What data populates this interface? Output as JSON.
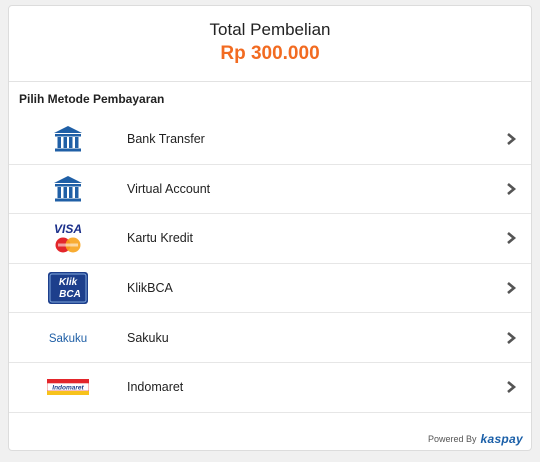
{
  "header": {
    "title": "Total Pembelian",
    "amount": "Rp 300.000"
  },
  "section_title": "Pilih Metode Pembayaran",
  "methods": [
    {
      "label": "Bank Transfer",
      "icon": "bank-icon"
    },
    {
      "label": "Virtual Account",
      "icon": "bank-icon"
    },
    {
      "label": "Kartu Kredit",
      "icon": "visa-mastercard-logo"
    },
    {
      "label": "KlikBCA",
      "icon": "klikbca-logo"
    },
    {
      "label": "Sakuku",
      "icon": "sakuku-logo"
    },
    {
      "label": "Indomaret",
      "icon": "indomaret-logo"
    }
  ],
  "logos": {
    "visa": "VISA",
    "klik": "Klik",
    "bca": "BCA",
    "sakuku": "Sakuku",
    "indomaret": "Indomaret"
  },
  "footer": {
    "powered_by": "Powered By",
    "brand": "kaspay"
  },
  "colors": {
    "accent": "#f26b21",
    "bank_blue": "#1f5fa6",
    "chevron": "#555555"
  }
}
